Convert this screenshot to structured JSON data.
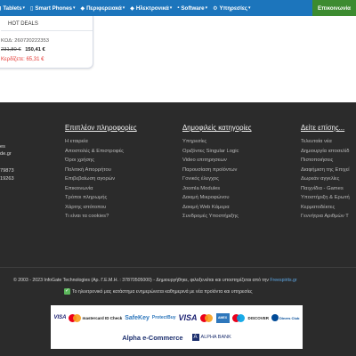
{
  "nav": {
    "items": [
      {
        "label": "Tablets",
        "icon": "tablet-icon"
      },
      {
        "label": "Smart Phones",
        "icon": "phone-icon"
      },
      {
        "label": "Περιφερειακά",
        "icon": "peripherals-icon"
      },
      {
        "label": "Ηλεκτρονικά",
        "icon": "electronics-icon"
      },
      {
        "label": "Software",
        "icon": "software-icon"
      },
      {
        "label": "Υπηρεσίες",
        "icon": "services-icon"
      }
    ],
    "contact_label": "Επικοινωνία"
  },
  "product_card": {
    "badge": "HOT DEALS",
    "code": "ΚΩΔ: 260720222353",
    "old_price": "231,80 €",
    "new_price": "150,41 €",
    "savings": "Κερδίζετε: 65,31 €"
  },
  "footer": {
    "brand_fragments": [
      "es",
      "de.gr",
      "",
      "79873",
      "19263"
    ],
    "columns": [
      {
        "title": "Επιπλέον πληροφορίες",
        "links": [
          "Η εταιρεία",
          "Αποστολές & Επιστροφές",
          "Όροι χρήσης",
          "Πολιτική Απορρήτου",
          "Επιβεβαίωση αγορών",
          "Επικοινωνία",
          "Τρόποι πληρωμής",
          "Χάρτης ιστότοπου",
          "Τι είναι τα cookies?"
        ]
      },
      {
        "title": "Δημοφιλείς κατηγορίες",
        "links": [
          "Υπηρεσίες",
          "Οριζόντες Singular Logic",
          "Video επιτηρησεων",
          "Παρουσίαση προϊόντων",
          "Γονικός έλεγχος",
          "Joomla Modules",
          "Δοκιμή Μικροφώνου",
          "Δοκιμή Web Κάμερα",
          "Συνδρομές Υποστήριξης"
        ]
      },
      {
        "title": "Δείτε επίσης...",
        "links": [
          "Τελευταία νέα",
          "Δημιουργία ιστοσελίδ",
          "Πιστοποιήσεις",
          "Διαφήμιση της Επιχεί",
          "Δωρεάν αγγελίες",
          "Παιχνίδια - Games",
          "Υποστήριξη & Ερωτή",
          "Κερματοδέκτες",
          "Γεννήτρια Αριθμών Τ"
        ]
      }
    ],
    "copyright_prefix": "© 2003 - 2023 InfoGate Technologies (Αρ. Γ.Ε.Μ.Η. : 37870505000) - Δημιουργήθηκε, φιλοξενείται και υποστηρίζεται από την",
    "copyright_link": "Freespirits.gr",
    "newsletter": "Το ηλεκτρονικό μας κατάστημα ενημερώνεται καθημερινά με νέα προϊόντα και υπηρεσίες",
    "payments": {
      "row1": [
        "VISA",
        "mastercard ID Check",
        "SafeKey",
        "ProtectBuy",
        "VISA",
        "Mastercard",
        "American Express",
        "Maestro",
        "DISCOVER",
        "Diners Club"
      ],
      "alpha_ecommerce": "Alpha e-Commerce",
      "alpha_bank": "ALPHA BANK"
    }
  },
  "colors": {
    "nav_bg": "#1c75bc",
    "contact_bg": "#3c8b30",
    "footer_bg": "#2b2b2b",
    "price_red": "#e53935"
  }
}
